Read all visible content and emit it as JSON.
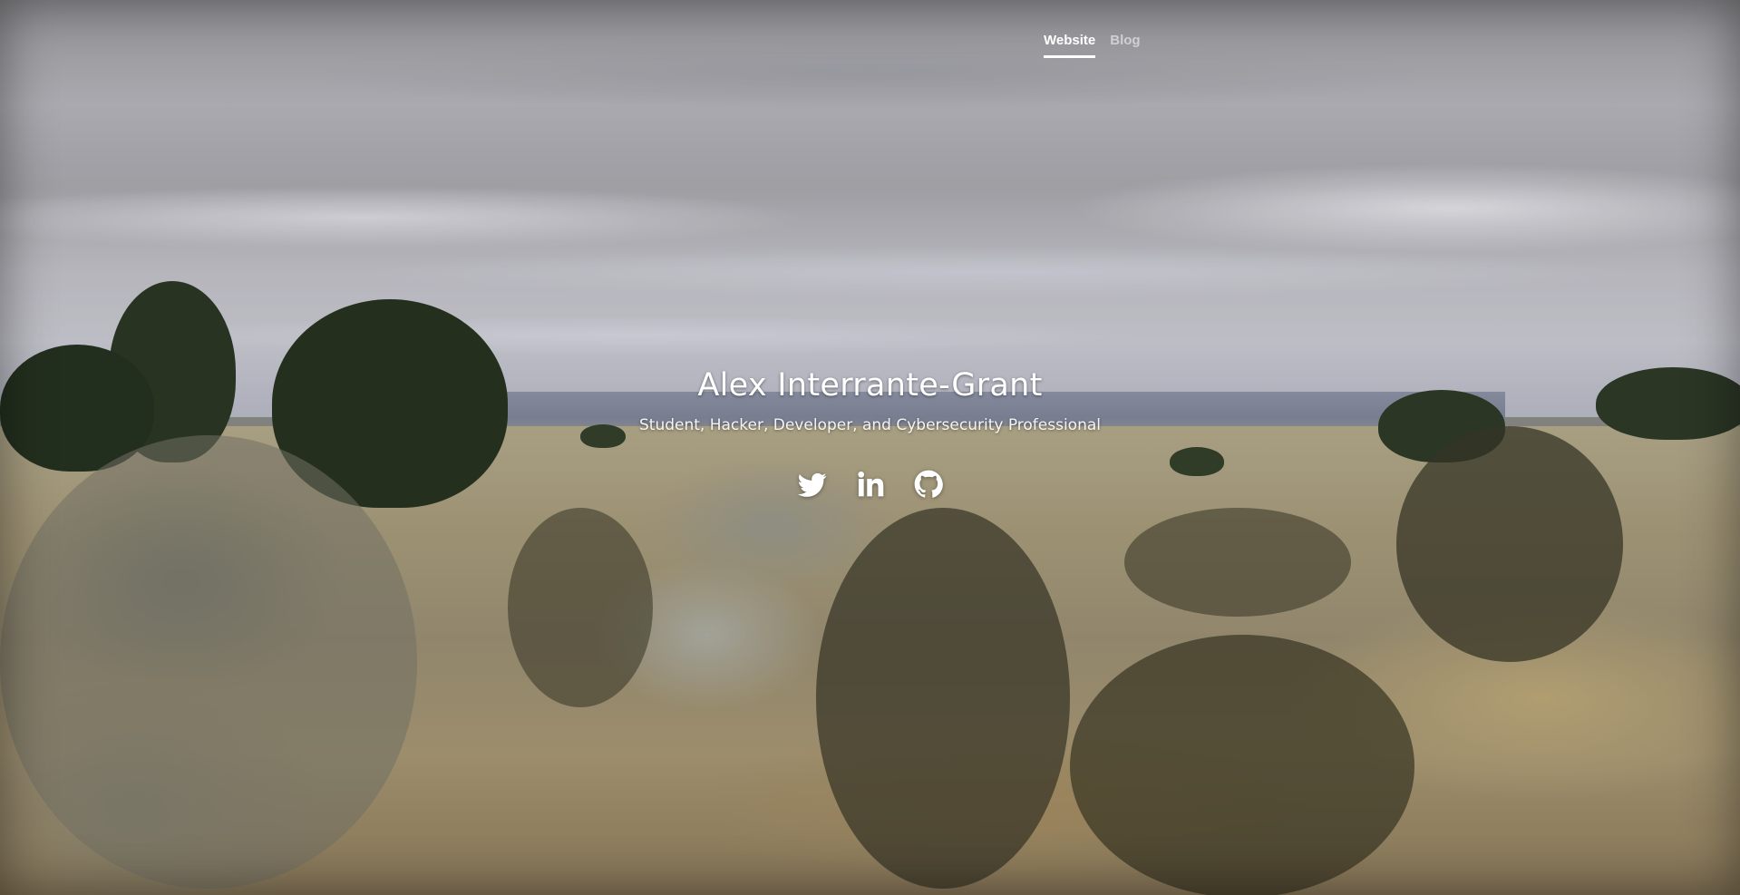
{
  "nav": {
    "items": [
      {
        "label": "Website",
        "active": true
      },
      {
        "label": "Blog",
        "active": false
      }
    ]
  },
  "intro": {
    "name": "Alex Interrante-Grant",
    "tagline": "Student, Hacker, Developer, and Cybersecurity Professional"
  },
  "social": [
    {
      "icon": "twitter-icon"
    },
    {
      "icon": "linkedin-icon"
    },
    {
      "icon": "github-icon"
    }
  ],
  "colors": {
    "text": "#ffffff",
    "nav_inactive": "rgba(255,255,255,0.55)"
  }
}
